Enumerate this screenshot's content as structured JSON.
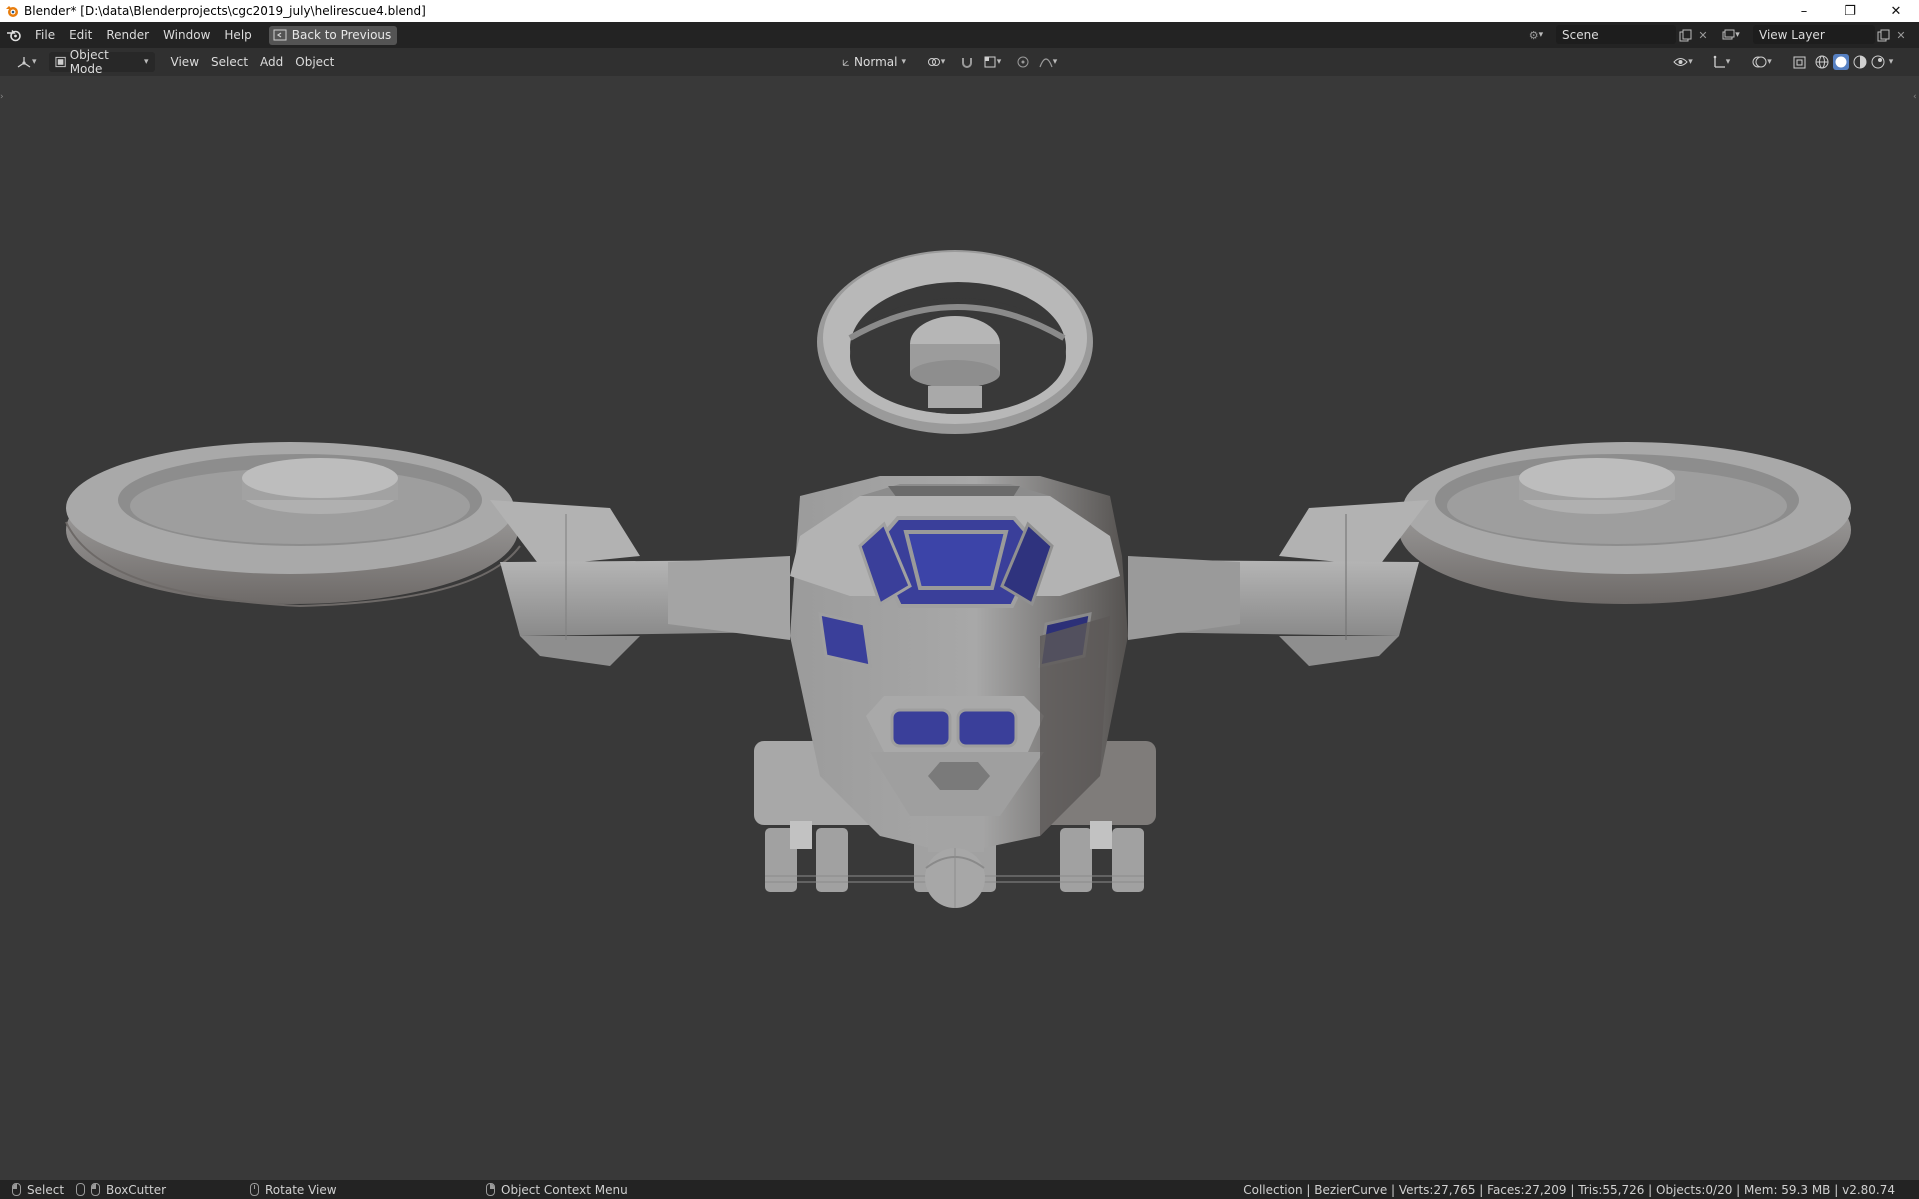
{
  "window": {
    "title": "Blender* [D:\\data\\Blenderprojects\\cgc2019_july\\helirescue4.blend]",
    "controls": [
      "minimize",
      "restore",
      "close"
    ]
  },
  "topbar": {
    "menus": [
      "File",
      "Edit",
      "Render",
      "Window",
      "Help"
    ],
    "back_button": "Back to Previous",
    "scene_name": "Scene",
    "view_layer": "View Layer"
  },
  "header": {
    "mode": "Object Mode",
    "menus": [
      "View",
      "Select",
      "Add",
      "Object"
    ],
    "orientation": "Normal"
  },
  "statusbar": {
    "select": "Select",
    "boxcutter": "BoxCutter",
    "rotate": "Rotate View",
    "context_menu": "Object Context Menu",
    "stats": "Collection | BezierCurve | Verts:27,765 | Faces:27,209 | Tris:55,726 | Objects:0/20 | Mem: 59.3 MB | v2.80.74"
  },
  "colors": {
    "viewport_bg": "#393939",
    "window_glass": "#3a3f9a",
    "model_gray": "#a6a6a6"
  }
}
